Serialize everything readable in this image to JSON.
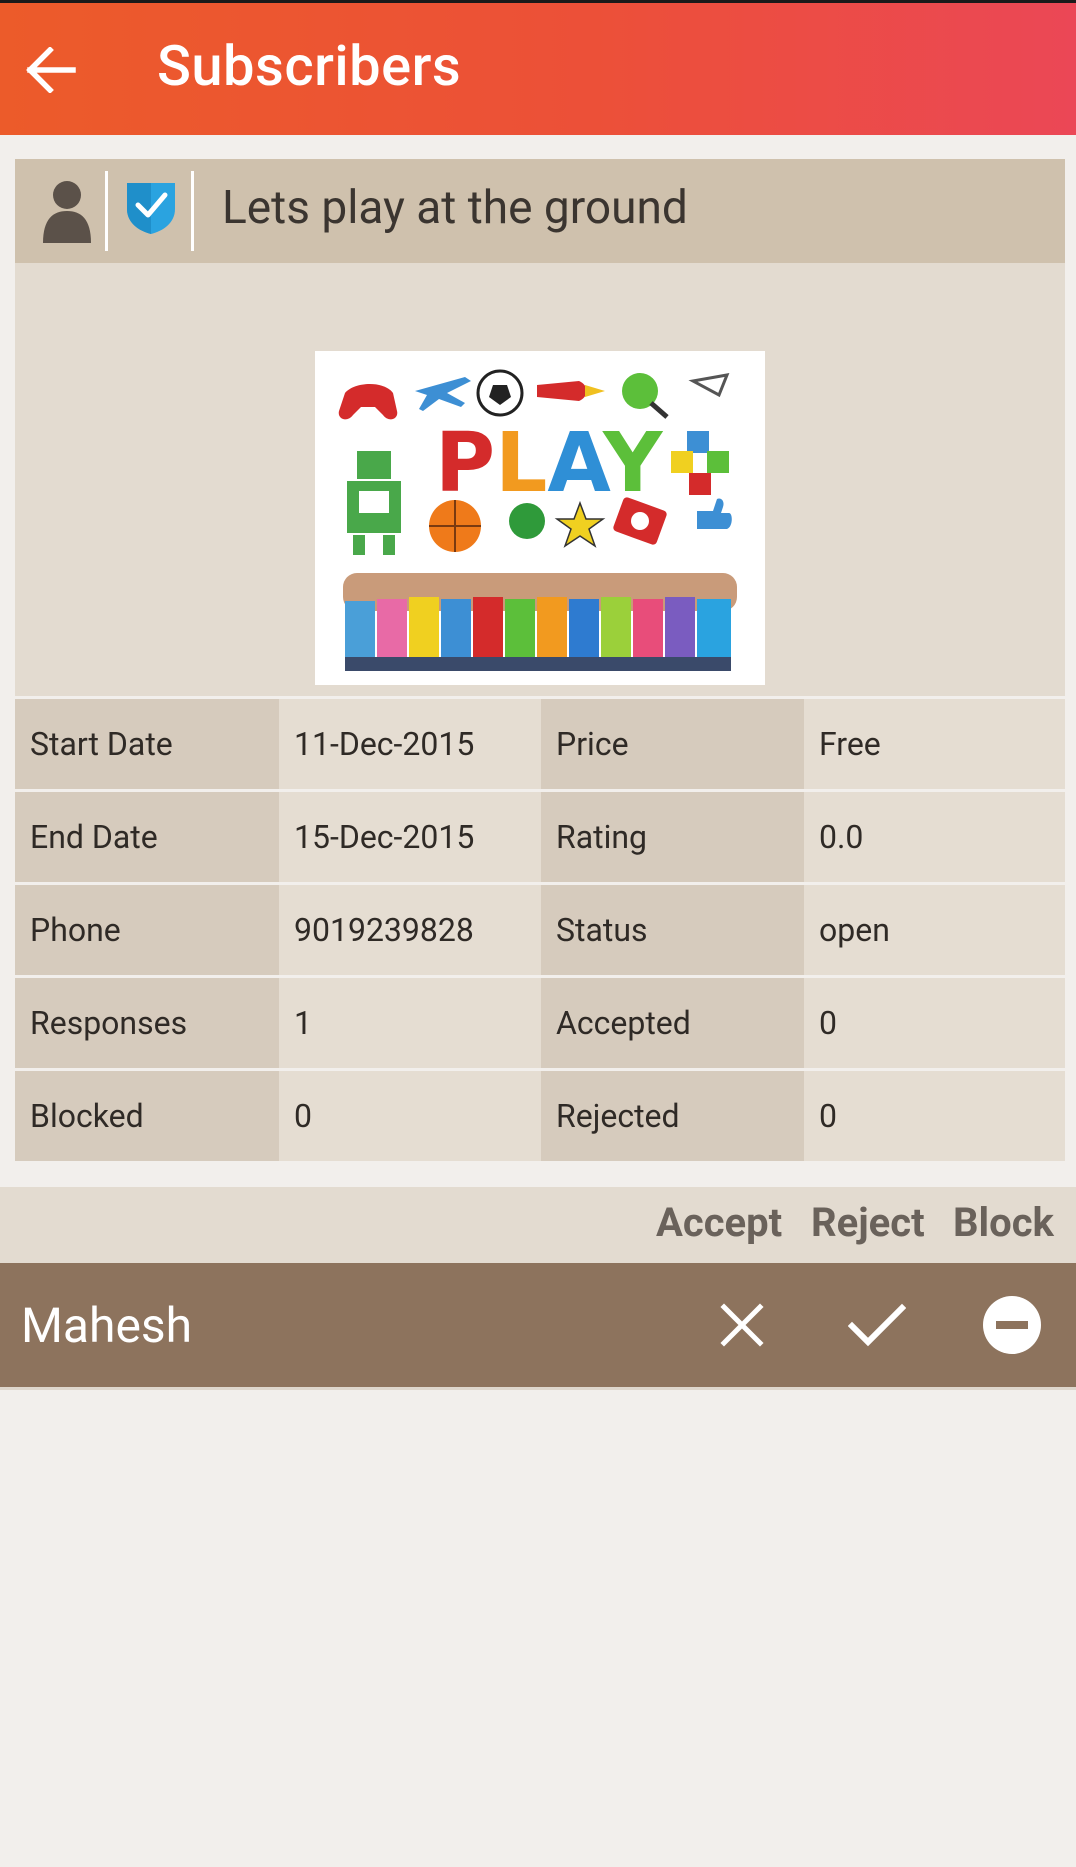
{
  "appbar": {
    "title": "Subscribers",
    "back_icon": "arrow-left-icon"
  },
  "event": {
    "title": "Lets play at the ground",
    "avatar_icon": "user-silhouette-icon",
    "verified_icon": "verified-shield-icon",
    "image_text": "PLAY"
  },
  "details": {
    "rows": [
      {
        "label1": "Start Date",
        "value1": "11-Dec-2015",
        "label2": "Price",
        "value2": "Free"
      },
      {
        "label1": "End Date",
        "value1": "15-Dec-2015",
        "label2": "Rating",
        "value2": "0.0"
      },
      {
        "label1": "Phone",
        "value1": "9019239828",
        "label2": "Status",
        "value2": "open"
      },
      {
        "label1": "Responses",
        "value1": "1",
        "label2": "Accepted",
        "value2": "0"
      },
      {
        "label1": "Blocked",
        "value1": "0",
        "label2": "Rejected",
        "value2": "0"
      }
    ]
  },
  "actions": {
    "accept": "Accept",
    "reject": "Reject",
    "block": "Block"
  },
  "subscriber": {
    "name": "Mahesh",
    "icons": [
      "close-icon",
      "check-icon",
      "minus-circle-icon"
    ]
  },
  "colors": {
    "appbar_start": "#ec5b2a",
    "appbar_end": "#eb4756",
    "card_header": "#cfc1ad",
    "subscriber_row": "#8d735d",
    "verified_blue": "#2aa3e0"
  }
}
